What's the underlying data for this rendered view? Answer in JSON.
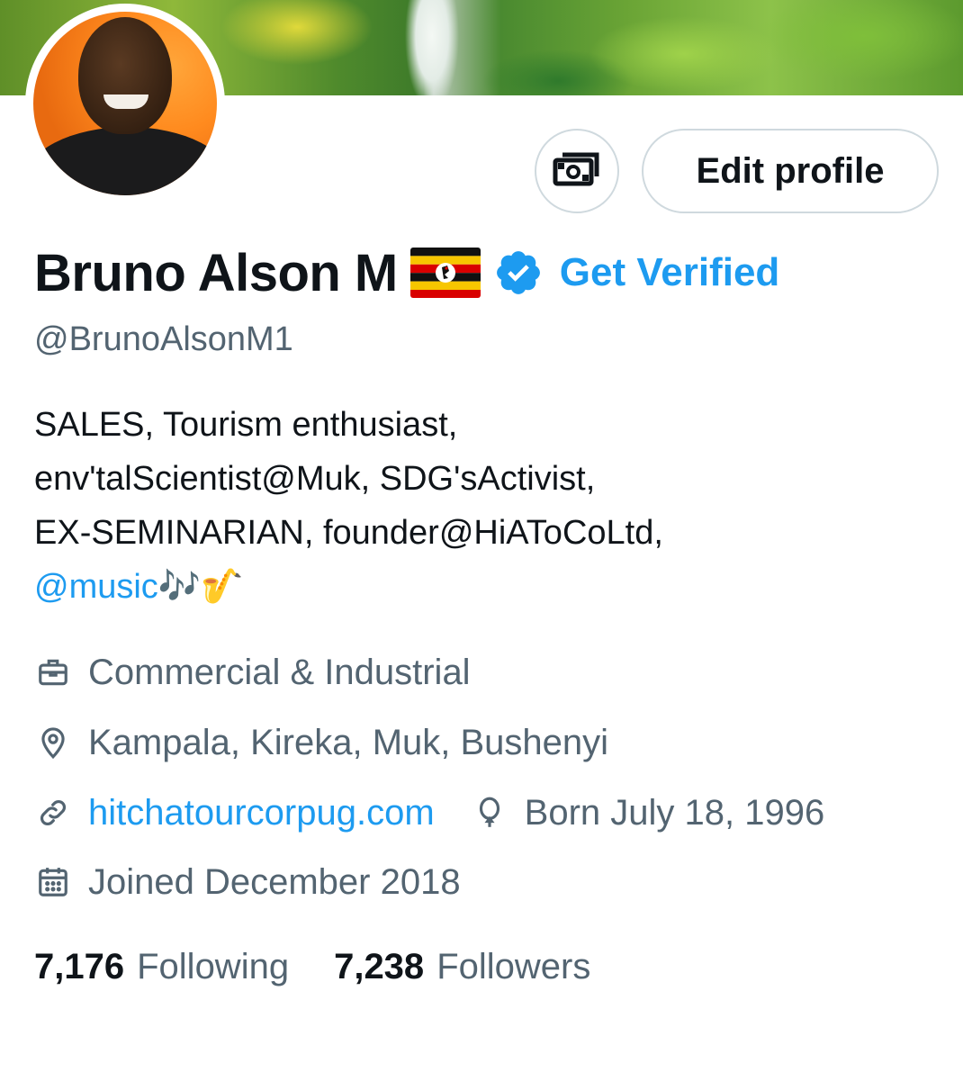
{
  "profile": {
    "display_name": "Bruno Alson M",
    "name_emoji": "Uganda flag",
    "get_verified_label": "Get Verified",
    "handle": "@BrunoAlsonM1",
    "bio_lines": [
      "SALES, Tourism enthusiast,",
      "env'talScientist@Muk, SDG'sActivist,",
      "EX-SEMINARIAN, founder@HiAToCoLtd,"
    ],
    "bio_mention": "@music",
    "bio_trailing_emoji": "🎶🎷",
    "category": "Commercial & Industrial",
    "location": "Kampala, Kireka, Muk, Bushenyi",
    "website": "hitchatourcorpug.com",
    "birth": "Born July 18, 1996",
    "joined": "Joined December 2018",
    "following_count": "7,176",
    "following_label": "Following",
    "followers_count": "7,238",
    "followers_label": "Followers"
  },
  "actions": {
    "edit_profile_label": "Edit profile",
    "tip_icon": "money-icon"
  },
  "colors": {
    "accent": "#1d9bf0",
    "text_primary": "#0f1419",
    "text_secondary": "#536471",
    "border": "#cfd9de"
  }
}
